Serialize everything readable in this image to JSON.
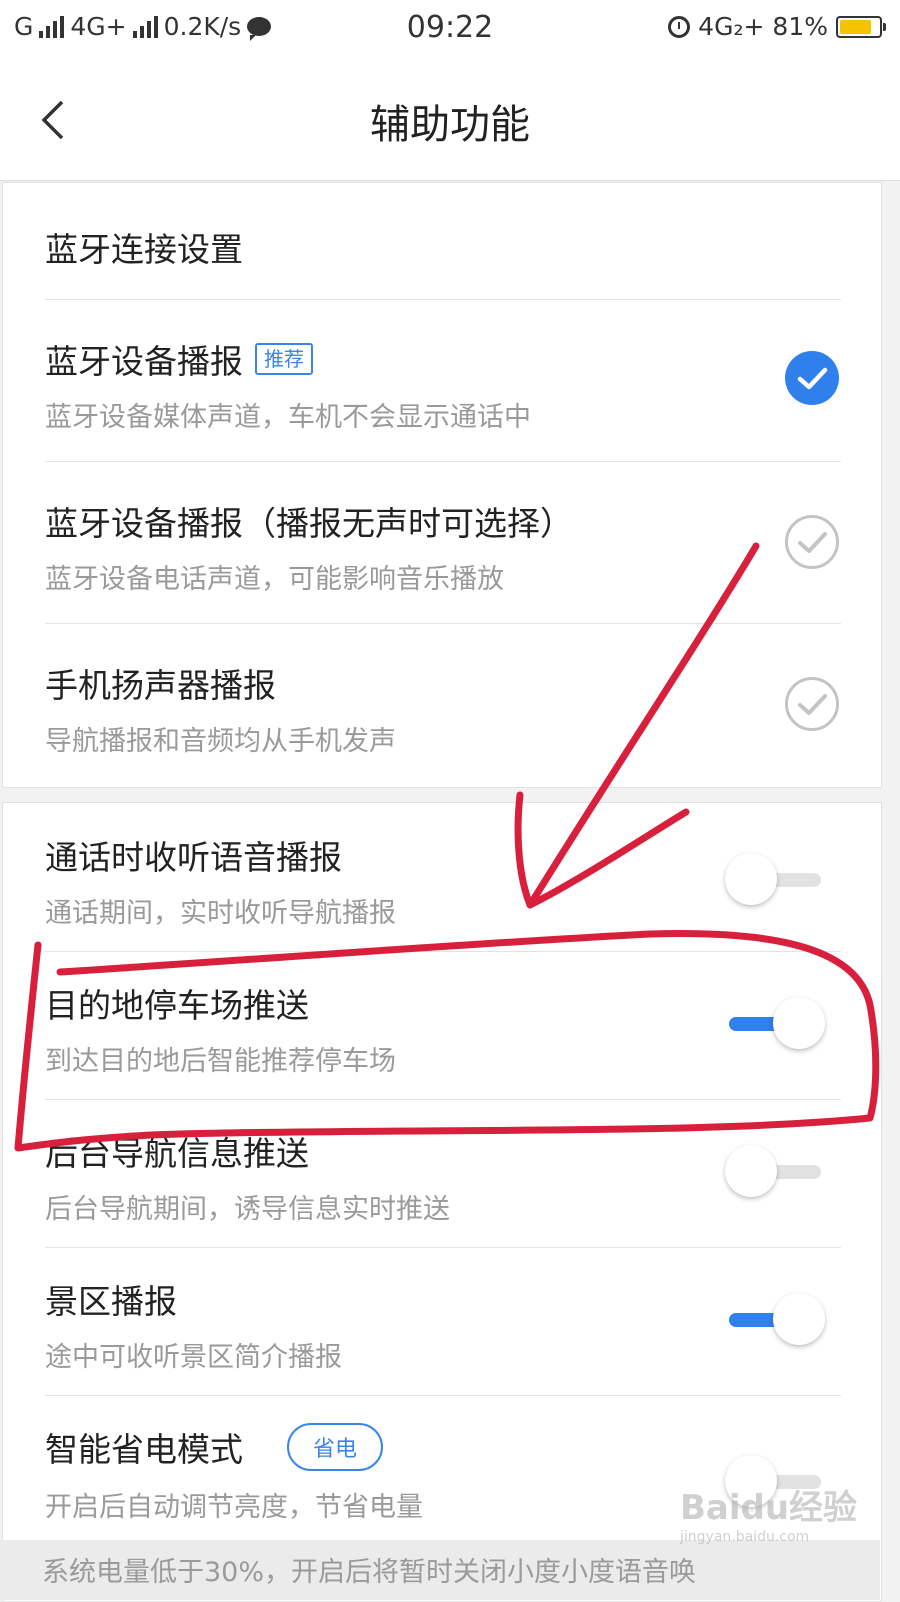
{
  "status_bar": {
    "carrier1": "G",
    "carrier2": "4G+",
    "speed": "0.2K/s",
    "time": "09:22",
    "network": "4G₂+",
    "battery": "81%",
    "battery_level": 0.81,
    "battery_color": "#f4c400"
  },
  "header": {
    "title": "辅助功能",
    "back_icon": "chevron-left-icon"
  },
  "section1": {
    "header": "蓝牙连接设置",
    "items": [
      {
        "title": "蓝牙设备播报",
        "tag": "推荐",
        "subtitle": "蓝牙设备媒体声道，车机不会显示通话中",
        "selected": true
      },
      {
        "title": "蓝牙设备播报（播报无声时可选择）",
        "subtitle": "蓝牙设备电话声道，可能影响音乐播放",
        "selected": false
      },
      {
        "title": "手机扬声器播报",
        "subtitle": "导航播报和音频均从手机发声",
        "selected": false
      }
    ]
  },
  "section2": {
    "items": [
      {
        "title": "通话时收听语音播报",
        "subtitle": "通话期间，实时收听导航播报",
        "enabled": false
      },
      {
        "title": "目的地停车场推送",
        "subtitle": "到达目的地后智能推荐停车场",
        "enabled": true
      },
      {
        "title": "后台导航信息推送",
        "subtitle": "后台导航期间，诱导信息实时推送",
        "enabled": false
      },
      {
        "title": "景区播报",
        "subtitle": "途中可收听景区简介播报",
        "enabled": true
      },
      {
        "title": "智能省电模式",
        "pill": "省电",
        "subtitle": "开启后自动调节亮度，节省电量",
        "enabled": false
      }
    ],
    "footer_note": "系统电量低于30%，开启后将暂时关闭小度小度语音唤"
  },
  "watermark": {
    "logo": "Baidu经验",
    "url": "jingyan.baidu.com"
  },
  "colors": {
    "accent": "#2f80ed",
    "annotation": "#d8203c"
  }
}
